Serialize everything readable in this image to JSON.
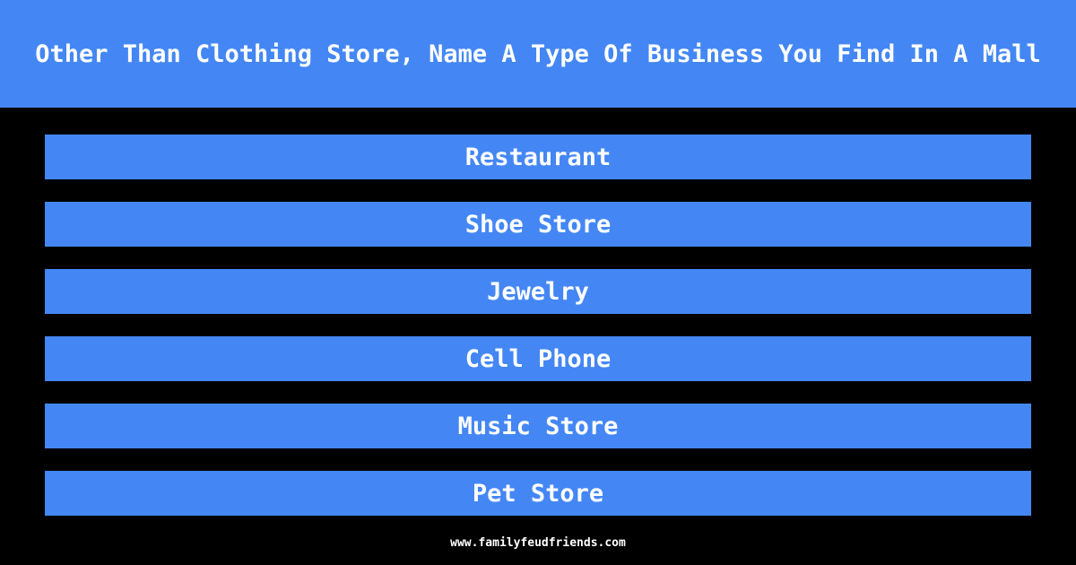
{
  "question": "Other Than Clothing Store, Name A Type Of Business You Find In A Mall",
  "answers": [
    {
      "label": "Restaurant"
    },
    {
      "label": "Shoe Store"
    },
    {
      "label": "Jewelry"
    },
    {
      "label": "Cell Phone"
    },
    {
      "label": "Music Store"
    },
    {
      "label": "Pet Store"
    }
  ],
  "footer": {
    "url": "www.familyfeudfriends.com"
  },
  "colors": {
    "accent": "#4487f4",
    "background": "#000000",
    "text": "#ffffff"
  }
}
